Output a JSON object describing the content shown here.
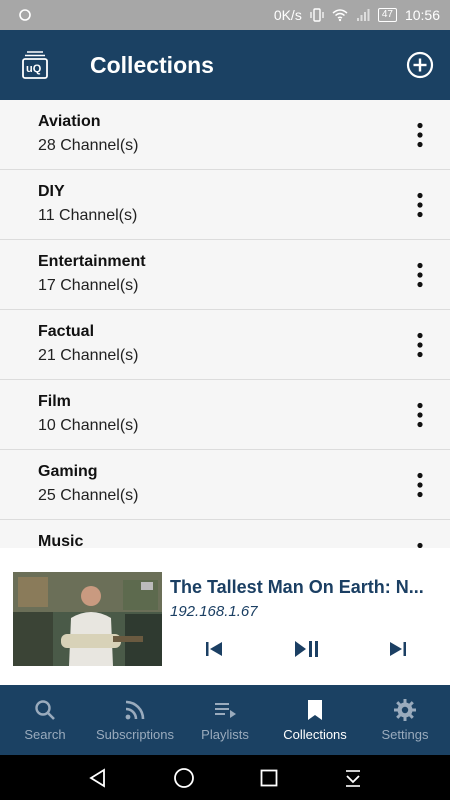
{
  "status_bar": {
    "speed": "0K/s",
    "battery": "47",
    "time": "10:56"
  },
  "app_bar": {
    "logo_text": "uQ",
    "title": "Collections"
  },
  "collections": [
    {
      "name": "Aviation",
      "count": "28 Channel(s)"
    },
    {
      "name": "DIY",
      "count": "11 Channel(s)"
    },
    {
      "name": "Entertainment",
      "count": "17 Channel(s)"
    },
    {
      "name": "Factual",
      "count": "21 Channel(s)"
    },
    {
      "name": "Film",
      "count": "10 Channel(s)"
    },
    {
      "name": "Gaming",
      "count": "25 Channel(s)"
    },
    {
      "name": "Music",
      "count": ""
    }
  ],
  "player": {
    "title": "The Tallest Man On Earth: N...",
    "ip": "192.168.1.67"
  },
  "bottom_nav": [
    {
      "label": "Search",
      "icon": "search-icon",
      "active": false
    },
    {
      "label": "Subscriptions",
      "icon": "rss-icon",
      "active": false
    },
    {
      "label": "Playlists",
      "icon": "playlist-icon",
      "active": false
    },
    {
      "label": "Collections",
      "icon": "bookmark-icon",
      "active": true
    },
    {
      "label": "Settings",
      "icon": "gear-icon",
      "active": false
    }
  ],
  "colors": {
    "primary": "#1b4163",
    "accent": "#1b3f63",
    "status_bar": "#a7a7a7"
  }
}
